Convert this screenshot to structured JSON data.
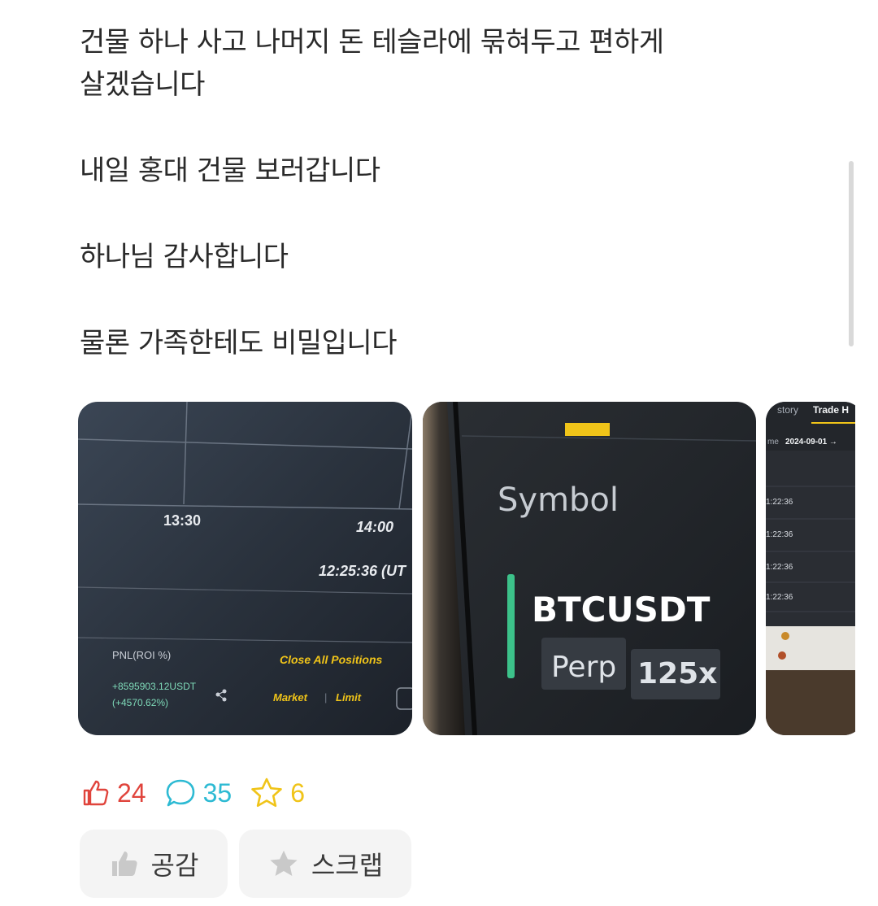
{
  "post": {
    "paragraphs": [
      "건물 하나 사고 나머지 돈 테슬라에  묶혀두고 편하게\n살겠습니다",
      "내일 홍대 건물 보러갑니다",
      "하나님 감사합니다",
      "물론 가족한테도 비밀입니다"
    ]
  },
  "images": {
    "image1": {
      "time_left": "13:30",
      "time_right": "14:00",
      "timestamp": "12:25:36 (UT",
      "pnl_label": "PNL(ROI %)",
      "close_all": "Close All Positions",
      "pnl_value": "+8595903.12USDT",
      "roi_value": "(+4570.62%)",
      "market_tab": "Market",
      "divider": "|",
      "limit_tab": "Limit"
    },
    "image2": {
      "symbol_header": "Symbol",
      "pair": "BTCUSDT",
      "contract_type": "Perp",
      "leverage": "125x"
    },
    "image3": {
      "tab_history": "story",
      "tab_trade": "Trade H",
      "date_label": "me",
      "date_value": "2024-09-01 →",
      "rows": [
        "1:22:36",
        "1:22:36",
        "1:22:36",
        "1:22:36"
      ]
    }
  },
  "reactions": {
    "likes": "24",
    "comments": "35",
    "scraps": "6"
  },
  "actions": {
    "like_label": "공감",
    "scrap_label": "스크랩"
  },
  "colors": {
    "like": "#e0443c",
    "comment": "#2dbad3",
    "star": "#f0c419",
    "pnl_green": "#7ed9b8",
    "close_all_yellow": "#f0c419"
  }
}
